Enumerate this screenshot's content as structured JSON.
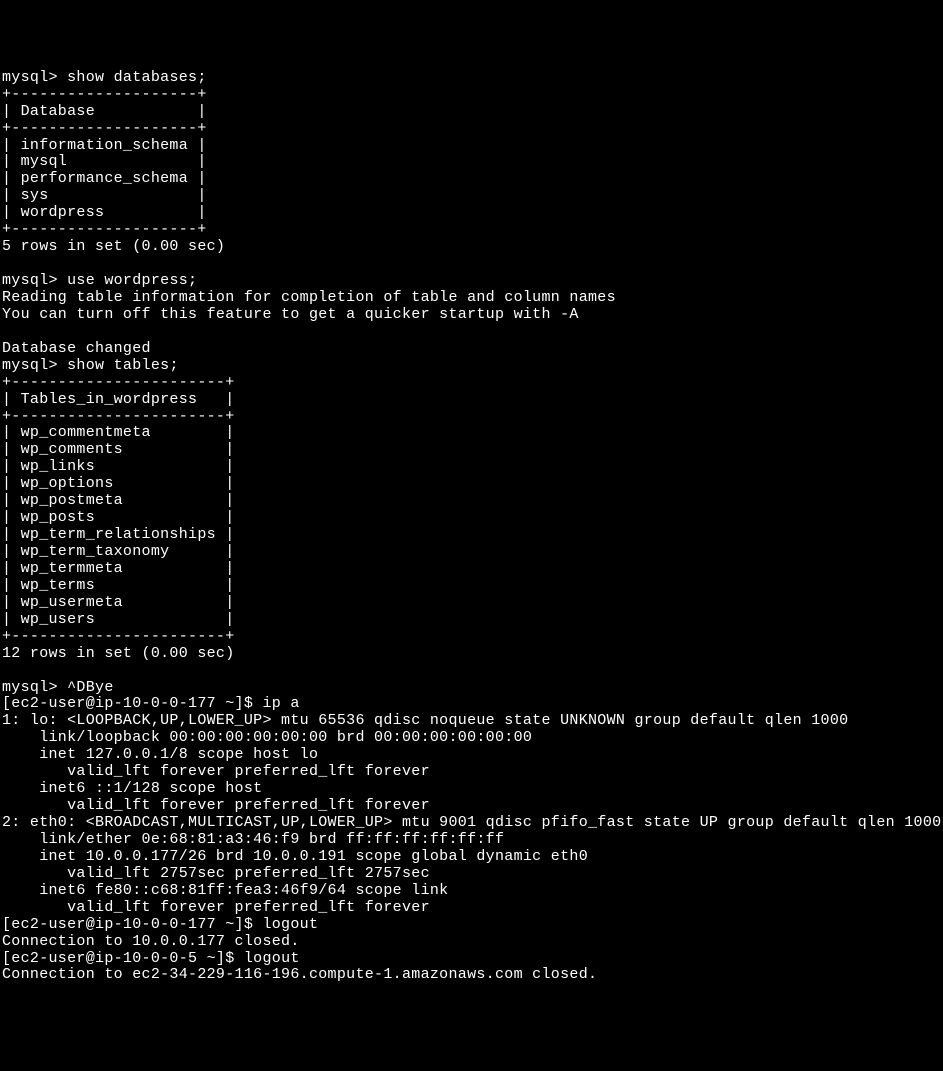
{
  "mysql": {
    "prompt": "mysql>",
    "cmd_show_databases": "show databases;",
    "db_table_border": "+--------------------+",
    "db_header": "| Database           |",
    "databases": [
      "| information_schema |",
      "| mysql              |",
      "| performance_schema |",
      "| sys                |",
      "| wordpress          |"
    ],
    "db_result_footer": "5 rows in set (0.00 sec)",
    "cmd_use_wordpress": "use wordpress;",
    "reading_msg1": "Reading table information for completion of table and column names",
    "reading_msg2": "You can turn off this feature to get a quicker startup with -A",
    "db_changed": "Database changed",
    "cmd_show_tables": "show tables;",
    "tables_border": "+-----------------------+",
    "tables_header": "| Tables_in_wordpress   |",
    "tables": [
      "| wp_commentmeta        |",
      "| wp_comments           |",
      "| wp_links              |",
      "| wp_options            |",
      "| wp_postmeta           |",
      "| wp_posts              |",
      "| wp_term_relationships |",
      "| wp_term_taxonomy      |",
      "| wp_termmeta           |",
      "| wp_terms              |",
      "| wp_usermeta           |",
      "| wp_users              |"
    ],
    "tables_result_footer": "12 rows in set (0.00 sec)",
    "exit_cmd": "^DBye"
  },
  "shell": {
    "prompt1": "[ec2-user@ip-10-0-0-177 ~]$",
    "prompt2": "[ec2-user@ip-10-0-0-5 ~]$",
    "cmd_ip_a": "ip a",
    "cmd_logout": "logout",
    "ip_output": [
      "1: lo: <LOOPBACK,UP,LOWER_UP> mtu 65536 qdisc noqueue state UNKNOWN group default qlen 1000",
      "    link/loopback 00:00:00:00:00:00 brd 00:00:00:00:00:00",
      "    inet 127.0.0.1/8 scope host lo",
      "       valid_lft forever preferred_lft forever",
      "    inet6 ::1/128 scope host",
      "       valid_lft forever preferred_lft forever",
      "2: eth0: <BROADCAST,MULTICAST,UP,LOWER_UP> mtu 9001 qdisc pfifo_fast state UP group default qlen 1000",
      "    link/ether 0e:68:81:a3:46:f9 brd ff:ff:ff:ff:ff:ff",
      "    inet 10.0.0.177/26 brd 10.0.0.191 scope global dynamic eth0",
      "       valid_lft 2757sec preferred_lft 2757sec",
      "    inet6 fe80::c68:81ff:fea3:46f9/64 scope link",
      "       valid_lft forever preferred_lft forever"
    ],
    "conn_closed1": "Connection to 10.0.0.177 closed.",
    "conn_closed2": "Connection to ec2-34-229-116-196.compute-1.amazonaws.com closed."
  }
}
